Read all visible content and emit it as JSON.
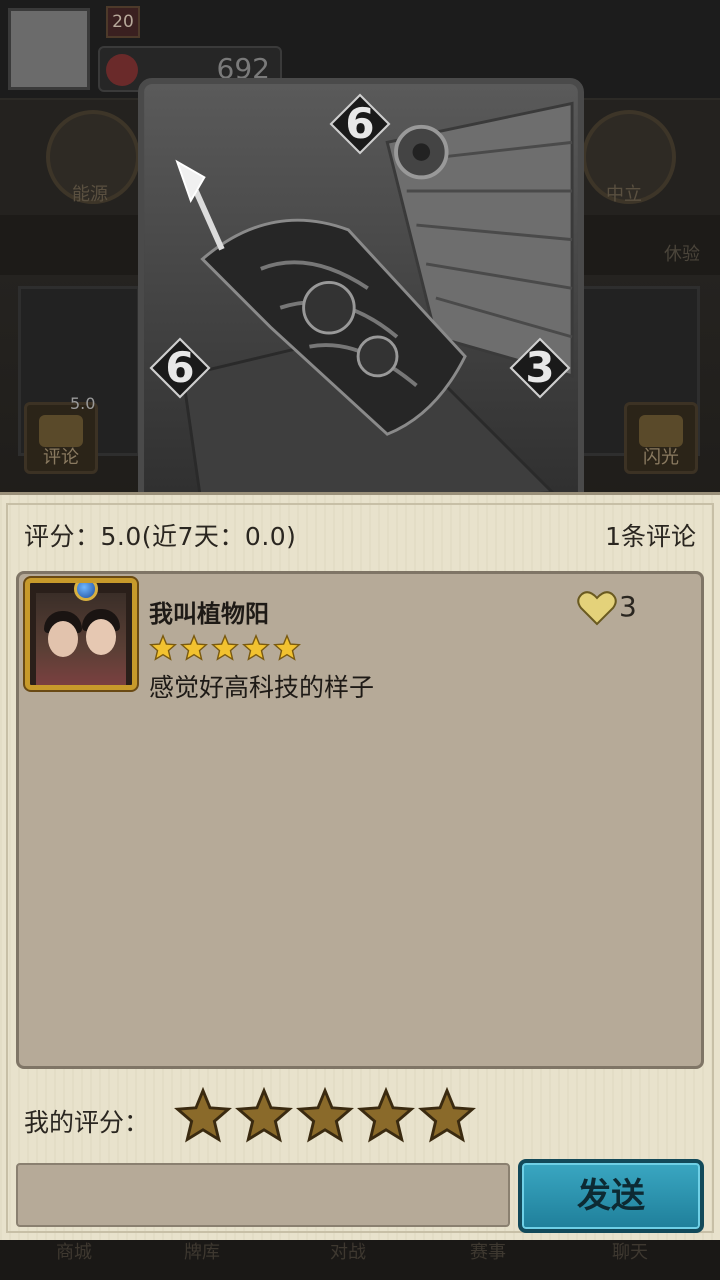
{
  "background": {
    "player_level": "20",
    "coins": "692",
    "faction_left_label": "能源",
    "faction_right_label": "中立",
    "strip_label": "休验",
    "review_button_label": "评论",
    "review_button_badge": "5.0",
    "flash_button_label": "闪光",
    "nav_items": [
      "商城",
      "牌库",
      "对战",
      "赛事",
      "聊天"
    ]
  },
  "card": {
    "cost": "6",
    "attack": "6",
    "health": "3",
    "icon": "flying-machine-art"
  },
  "panel": {
    "score_text": "评分：5.0(近7天：0.0)",
    "comment_count": "1条评论",
    "comments": [
      {
        "name": "我叫植物阳",
        "stars": 5,
        "text": "感觉好高科技的样子",
        "likes": "3"
      }
    ],
    "my_rating_label": "我的评分：",
    "my_rating_stars": 5,
    "input_value": "",
    "send_label": "发送"
  },
  "colors": {
    "panel_bg": "#e8e2cc",
    "comment_box_bg": "#b6aa98",
    "star_gold": "#f2c230",
    "star_bronze": "#8a6a2a",
    "send_button": "#2a93ae"
  }
}
